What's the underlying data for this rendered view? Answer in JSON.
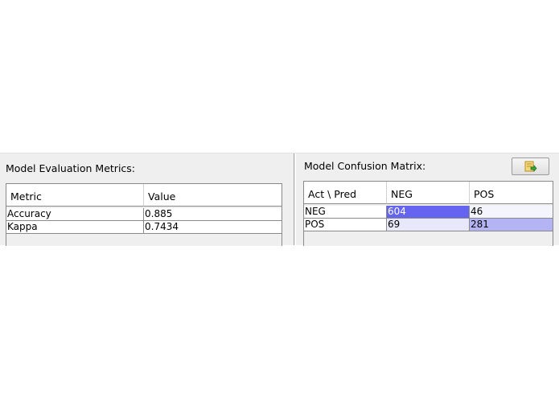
{
  "metrics_panel": {
    "title": "Model Evaluation Metrics:",
    "columns": [
      "Metric",
      "Value"
    ],
    "rows": [
      [
        "Accuracy",
        "0.885"
      ],
      [
        "Kappa",
        "0.7434"
      ]
    ]
  },
  "confusion_panel": {
    "title": "Model Confusion Matrix:",
    "columns": [
      "Act \\ Pred",
      "NEG",
      "POS"
    ],
    "rows": [
      [
        "NEG",
        "604",
        "46"
      ],
      [
        "POS",
        "69",
        "281"
      ]
    ],
    "export_icon": "export-icon"
  },
  "colors": {
    "cell_dark": "#6464f0",
    "cell_light": "#b4b4f5",
    "cell_pale": "#e8e8fb",
    "cell_faint": "#f4f4fd"
  }
}
